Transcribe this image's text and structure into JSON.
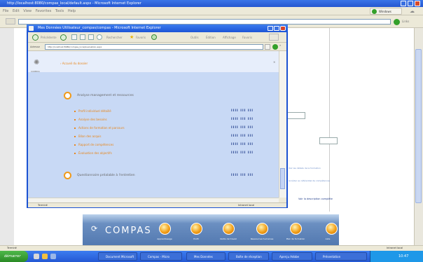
{
  "outer_window": {
    "title": "http://localhost:8080/compas_local/default.aspx - Microsoft Internet Explorer",
    "menu": [
      "File",
      "Edit",
      "View",
      "Favorites",
      "Tools",
      "Help"
    ],
    "go_label": "Windows",
    "links_label": "Links"
  },
  "banner": {
    "logo_text": "COMPAS",
    "items": [
      "Apprentissage",
      "Profil",
      "Outils de travail",
      "Ressources humaines",
      "Plan de formation",
      "Aide"
    ]
  },
  "right_panel": {
    "link1": "Voir les détails de la formation",
    "link2": "Accéder au référentiel de compétences",
    "link3": "Voir la description complète"
  },
  "popup": {
    "title": "Mes Données Utilisateur_compas/compas - Microsoft Internet Explorer",
    "back_label": "Précédente",
    "favorites_label": "Favoris",
    "menu": [
      "Outils",
      "Édition",
      "Affichage",
      "Favoris"
    ],
    "address_label": "Adresse",
    "address": "http://localhost:8080/compas_local/evaluation.aspx",
    "breadcrumb": "› Accueil du dossier",
    "logo_label": "COMPAS",
    "section1_title": "Analyse management et ressources",
    "items": [
      "Profil individuel détaillé",
      "Analyse des besoins",
      "Actions de formation et parcours",
      "Bilan des acquis",
      "Rapport de compétences",
      "Évaluation des objectifs"
    ],
    "rating": "IIII  III  III",
    "section2_title": "Questionnaire préalable à l'entretien",
    "status_left": "Terminé",
    "status_right": "Intranet local"
  },
  "outer_status": {
    "left": "Terminé",
    "right": "Intranet local"
  },
  "taskbar": {
    "start": "démarrer",
    "tasks": [
      "Document Microsoft",
      "Compas - Micro",
      "Mes Données",
      "Boîte de réception",
      "Aperçu Adobe",
      "Présentation"
    ],
    "clock": "10:47"
  }
}
